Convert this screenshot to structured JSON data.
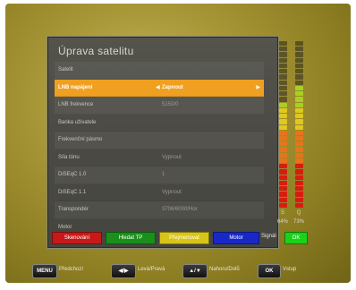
{
  "title": "Úprava satelitu",
  "rows": [
    {
      "label": "Satelit",
      "value": "",
      "dim": true
    },
    {
      "label": "LNB napájení",
      "value": "Zapnout",
      "selected": true
    },
    {
      "label": "LNB frekvence",
      "value": "5150/0",
      "dim": true
    },
    {
      "label": "Banka uživatele",
      "value": "",
      "dim": true
    },
    {
      "label": "Frekvenční pásmo",
      "value": "",
      "dim": true
    },
    {
      "label": "Síla tónu",
      "value": "Vypnout",
      "dim": true
    },
    {
      "label": "DiSEqC 1.0",
      "value": "1",
      "dim": true
    },
    {
      "label": "DiSEqC 1.1",
      "value": "Vypnout",
      "dim": true
    },
    {
      "label": "Transpondér",
      "value": "3706/6000/Hor",
      "dim": true
    },
    {
      "label": "Motor",
      "value": "",
      "dim": true
    }
  ],
  "meters": {
    "strength_label": "S",
    "quality_label": "Q",
    "strength_value": "64%",
    "quality_value": "73%",
    "strength_level": 0.64,
    "quality_level": 0.73
  },
  "color_buttons": [
    {
      "label": "Skenování",
      "color": "#c81818"
    },
    {
      "label": "Hledat TP",
      "color": "#1b8f1b"
    },
    {
      "label": "Přejmenovat",
      "color": "#d8c418"
    },
    {
      "label": "Motor",
      "color": "#1828c8"
    }
  ],
  "signal": {
    "label": "Signál",
    "status": "OK",
    "status_color": "#1bd21b"
  },
  "footer": [
    {
      "key": "MENU",
      "desc": "Předchozí"
    },
    {
      "key": "◀/▶",
      "desc": "Levá/Pravá"
    },
    {
      "key": "▲/▼",
      "desc": "Nahoru/Dolů"
    },
    {
      "key": "OK",
      "desc": "Vstup"
    }
  ],
  "colors": {
    "selection": "#f0a020",
    "panel": "#4e4d47"
  }
}
